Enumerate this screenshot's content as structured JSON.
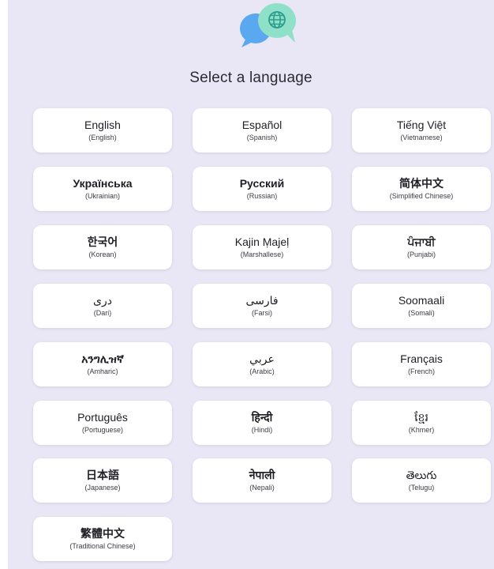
{
  "header": {
    "title": "Select a language"
  },
  "logo": {
    "icon": "chat-bubbles-globe-icon",
    "colors": {
      "bubble_back": "#5aa8ef",
      "bubble_front": "#8fe0c8",
      "globe": "#2b9c8e"
    }
  },
  "languages": [
    {
      "native": "English",
      "english": "(English)"
    },
    {
      "native": "Español",
      "english": "(Spanish)"
    },
    {
      "native": "Tiếng Việt",
      "english": "(Vietnamese)"
    },
    {
      "native": "Українська",
      "english": "(Ukrainian)"
    },
    {
      "native": "Русский",
      "english": "(Russian)"
    },
    {
      "native": "简体中文",
      "english": "(Simplified Chinese)"
    },
    {
      "native": "한국어",
      "english": "(Korean)"
    },
    {
      "native": "Kajin Ṃajeḷ",
      "english": "(Marshallese)"
    },
    {
      "native": "ਪੰਜਾਬੀ",
      "english": "(Punjabi)"
    },
    {
      "native": "دری",
      "english": "(Dari)"
    },
    {
      "native": "فارسی",
      "english": "(Farsi)"
    },
    {
      "native": "Soomaali",
      "english": "(Somali)"
    },
    {
      "native": "አንግሊዝኛ",
      "english": "(Amharic)"
    },
    {
      "native": "عربي",
      "english": "(Arabic)"
    },
    {
      "native": "Français",
      "english": "(French)"
    },
    {
      "native": "Português",
      "english": "(Portuguese)"
    },
    {
      "native": "हिन्दी",
      "english": "(Hindi)"
    },
    {
      "native": "ខ្មែរ",
      "english": "(Khmer)"
    },
    {
      "native": "日本語",
      "english": "(Japanese)"
    },
    {
      "native": "नेपाली",
      "english": "(Nepali)"
    },
    {
      "native": "తెలుగు",
      "english": "(Telugu)"
    },
    {
      "native": "繁體中文",
      "english": "(Traditional Chinese)"
    }
  ]
}
